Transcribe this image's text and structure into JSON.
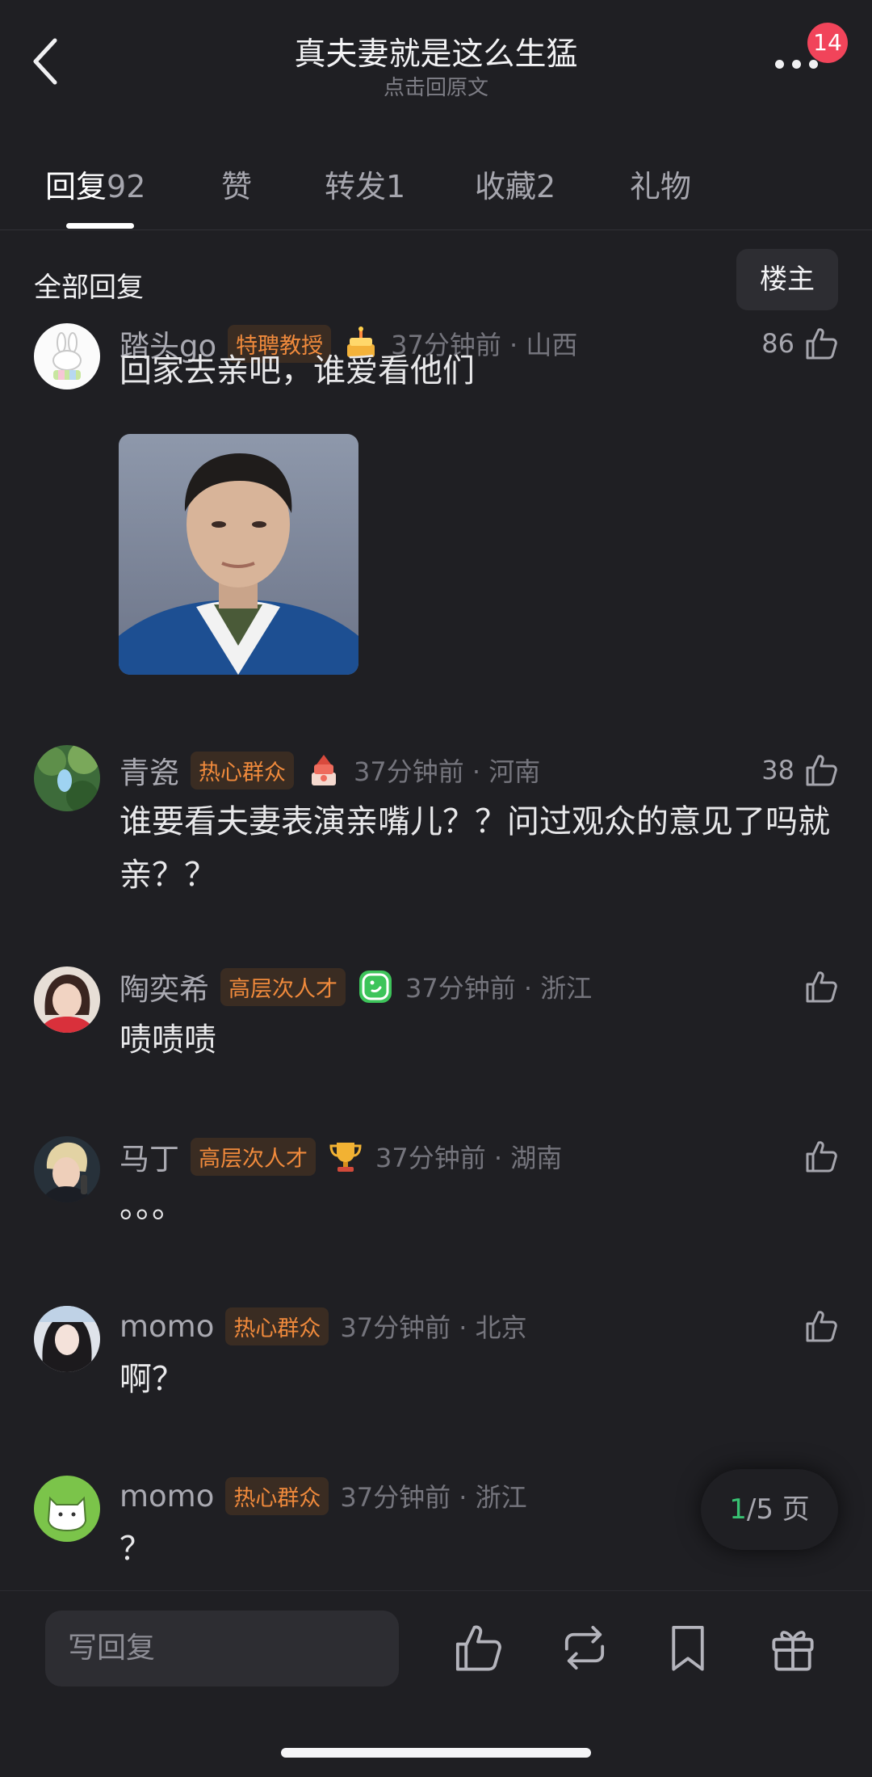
{
  "header": {
    "title": "真夫妻就是这么生猛",
    "subtitle": "点击回原文",
    "badge_count": "14",
    "icons": {
      "back": "chevron-left-icon",
      "more": "more-dots-icon"
    }
  },
  "tabs": [
    {
      "label": "回复",
      "count": "92",
      "active": true
    },
    {
      "label": "赞",
      "count": ""
    },
    {
      "label": "转发",
      "count": "1"
    },
    {
      "label": "收藏",
      "count": "2"
    },
    {
      "label": "礼物",
      "count": ""
    }
  ],
  "filter": {
    "title": "全部回复",
    "owner_button": "楼主"
  },
  "comments": [
    {
      "username": "踏头go",
      "tag": "特聘教授",
      "medal": "cake-medal-icon",
      "time": "37分钟前 · 山西",
      "likes": "86",
      "text": "回家去亲吧，谁爱看他们",
      "has_image": true
    },
    {
      "username": "青瓷",
      "tag": "热心群众",
      "medal": "cake-medal-icon",
      "time": "37分钟前 · 河南",
      "likes": "38",
      "text": "谁要看夫妻表演亲嘴儿？？问过观众的意见了吗就亲？？"
    },
    {
      "username": "陶奕希",
      "tag": "高层次人才",
      "medal": "green-smile-medal-icon",
      "time": "37分钟前 · 浙江",
      "likes": "",
      "text": "啧啧啧"
    },
    {
      "username": "马丁",
      "tag": "高层次人才",
      "medal": "trophy-icon",
      "time": "37分钟前 · 湖南",
      "likes": "",
      "text": "。。。"
    },
    {
      "username": "momo",
      "tag": "热心群众",
      "medal": "",
      "time": "37分钟前 · 北京",
      "likes": "",
      "text": "啊？"
    },
    {
      "username": "momo",
      "tag": "热心群众",
      "medal": "",
      "time": "37分钟前 · 浙江",
      "likes": "",
      "text": "？"
    }
  ],
  "pager": {
    "current": "1",
    "total_text": "/5 页"
  },
  "bottom_bar": {
    "reply_placeholder": "写回复",
    "icons": [
      "thumbs-up-icon",
      "repost-icon",
      "bookmark-icon",
      "gift-icon"
    ]
  },
  "colors": {
    "background": "#1f1f23",
    "tag_text": "#f08a3c",
    "badge": "#f1445a",
    "pager_current": "#38c172"
  }
}
